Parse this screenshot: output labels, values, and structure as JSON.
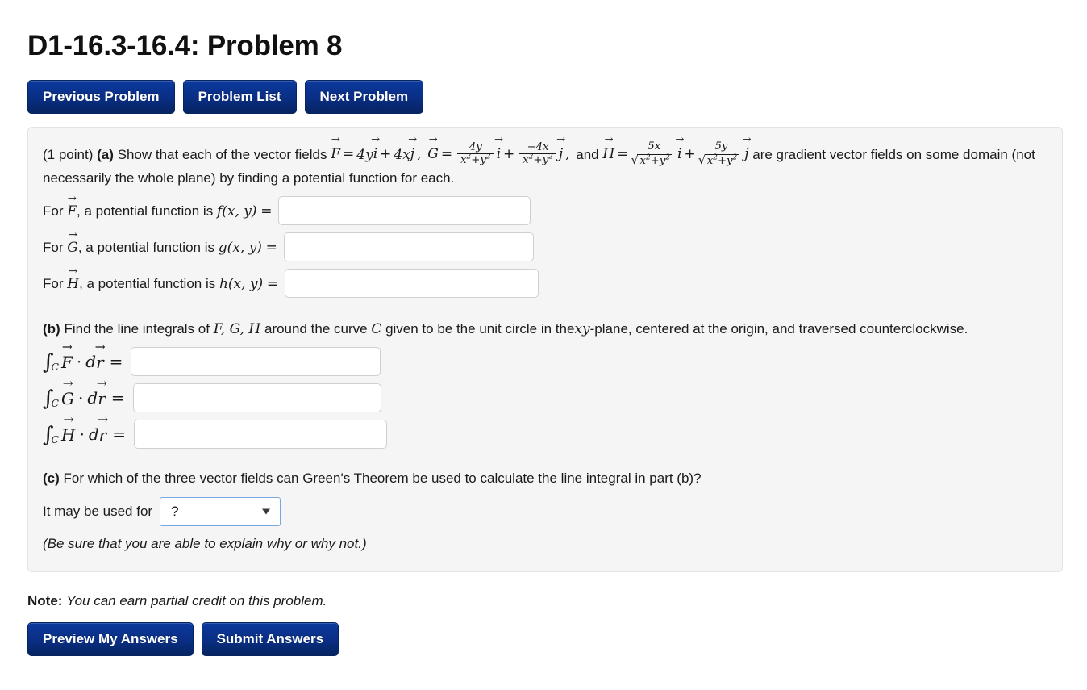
{
  "header": {
    "title": "D1-16.3-16.4: Problem 8"
  },
  "nav_buttons": [
    {
      "label": "Previous Problem",
      "name": "previous-problem-button"
    },
    {
      "label": "Problem List",
      "name": "problem-list-button"
    },
    {
      "label": "Next Problem",
      "name": "next-problem-button"
    }
  ],
  "problem": {
    "points": "(1 point)",
    "part_a": {
      "marker": "(a)",
      "intro": "Show that each of the vector fields",
      "F": {
        "name": "F",
        "term1_coef": "4y",
        "term1_unit": "i",
        "plus": "+",
        "term2_coef": "4x",
        "term2_unit": "j"
      },
      "G": {
        "name": "G",
        "num1": "4y",
        "den1": "x",
        "den1_exp": "2",
        "den1_tail": "+y",
        "den1_tail_exp": "2",
        "unit1": "i",
        "num2": "−4x",
        "unit2": "j"
      },
      "and_text": "and",
      "H": {
        "name": "H",
        "num1": "5x",
        "unit1": "i",
        "num2": "5y",
        "unit2": "j"
      },
      "tail": "are gradient vector fields on some domain (not necessarily the whole plane) by finding a potential function for each.",
      "rows": [
        {
          "prefix": "For",
          "vec": "F",
          "mid": ", a potential function is",
          "fn": "f",
          "args": "(x, y)",
          "eq": "=",
          "value": "",
          "placeholder": ""
        },
        {
          "prefix": "For",
          "vec": "G",
          "mid": ", a potential function is",
          "fn": "g",
          "args": "(x, y)",
          "eq": "=",
          "value": "",
          "placeholder": ""
        },
        {
          "prefix": "For",
          "vec": "H",
          "mid": ", a potential function is",
          "fn": "h",
          "args": "(x, y)",
          "eq": "=",
          "value": "",
          "placeholder": ""
        }
      ]
    },
    "part_b": {
      "marker": "(b)",
      "text_1": "Find the line integrals of",
      "fields": "F, G, H",
      "text_2": "around the curve",
      "curve": "C",
      "text_3": "given to be the unit circle in the",
      "plane": "xy",
      "text_4": "-plane, centered at the origin, and traversed counterclockwise.",
      "rows": [
        {
          "vec": "F",
          "sub": "C",
          "dr": "dr",
          "eq": "=",
          "value": "",
          "placeholder": ""
        },
        {
          "vec": "G",
          "sub": "C",
          "dr": "dr",
          "eq": "=",
          "value": "",
          "placeholder": ""
        },
        {
          "vec": "H",
          "sub": "C",
          "dr": "dr",
          "eq": "=",
          "value": "",
          "placeholder": ""
        }
      ]
    },
    "part_c": {
      "marker": "(c)",
      "question": "For which of the three vector fields can Green's Theorem be used to calculate the line integral in part (b)?",
      "select_prefix": "It may be used for",
      "selected_option": "?",
      "hint": "(Be sure that you are able to explain why or why not.)"
    }
  },
  "footer": {
    "note_label": "Note:",
    "note_text": "You can earn partial credit on this problem.",
    "buttons": [
      {
        "label": "Preview My Answers",
        "name": "preview-my-answers-button"
      },
      {
        "label": "Submit Answers",
        "name": "submit-answers-button"
      }
    ]
  },
  "colors": {
    "button_blue": "#0a2f86",
    "panel_bg": "#f5f5f5",
    "select_border": "#7aa7e0"
  }
}
